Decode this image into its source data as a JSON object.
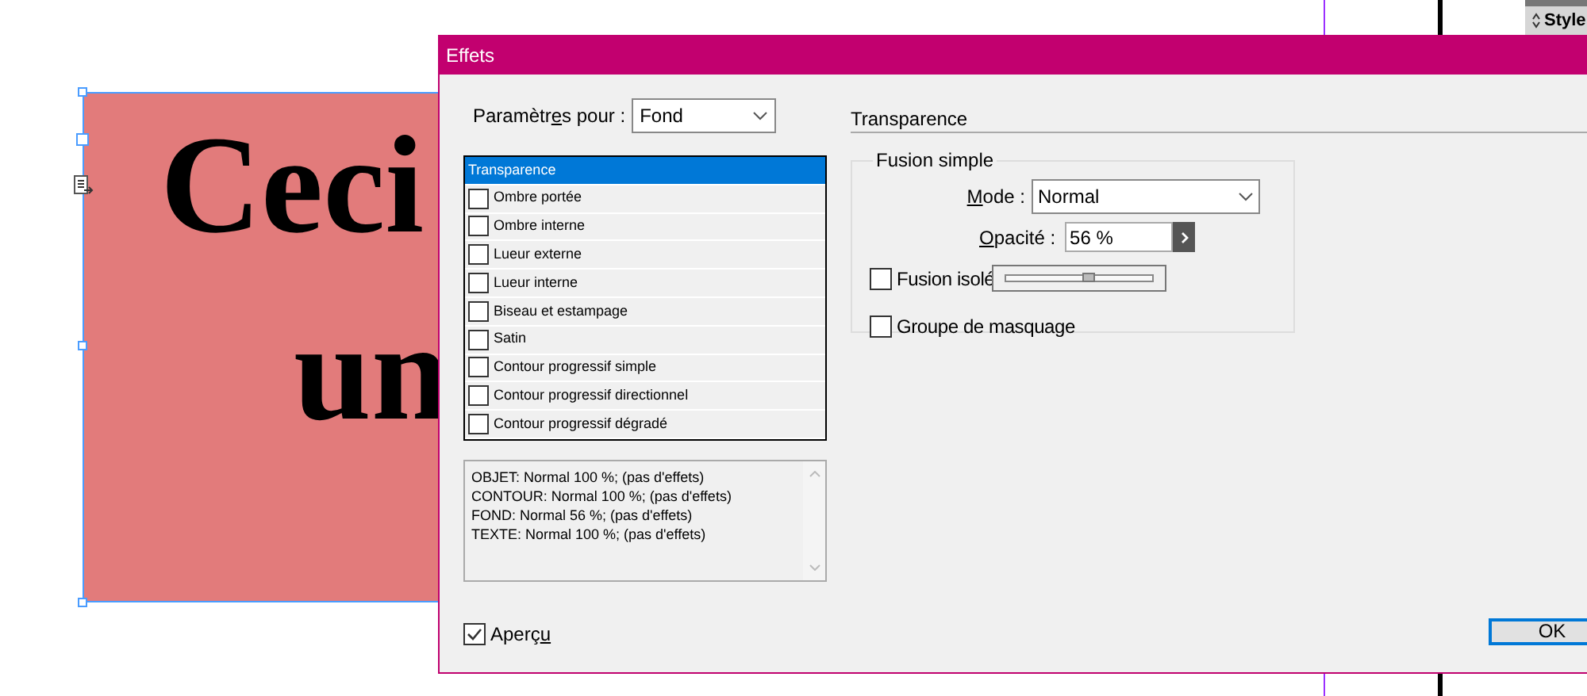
{
  "canvas": {
    "frame_lines": [
      "Ceci",
      "un"
    ],
    "panel_tab": {
      "label": "Style"
    }
  },
  "dialog": {
    "title": "Effets",
    "settings_for": {
      "label_parts": {
        "before": "Paramètr",
        "key": "e",
        "after": "s pour :"
      },
      "value": "Fond"
    },
    "effects": [
      {
        "kind": "plain",
        "label": "Transparence",
        "selected": true
      },
      {
        "kind": "checkbox",
        "label": "Ombre portée",
        "selected": false,
        "checked": false
      },
      {
        "kind": "checkbox",
        "label": "Ombre interne",
        "selected": false,
        "checked": false
      },
      {
        "kind": "checkbox",
        "label": "Lueur externe",
        "selected": false,
        "checked": false
      },
      {
        "kind": "checkbox",
        "label": "Lueur interne",
        "selected": false,
        "checked": false
      },
      {
        "kind": "checkbox",
        "label": "Biseau et estampage",
        "selected": false,
        "checked": false
      },
      {
        "kind": "checkbox",
        "label": "Satin",
        "selected": false,
        "checked": false
      },
      {
        "kind": "checkbox",
        "label": "Contour progressif simple",
        "selected": false,
        "checked": false
      },
      {
        "kind": "checkbox",
        "label": "Contour progressif directionnel",
        "selected": false,
        "checked": false
      },
      {
        "kind": "checkbox",
        "label": "Contour progressif dégradé",
        "selected": false,
        "checked": false
      }
    ],
    "summary": [
      "OBJET: Normal 100 %; (pas d'effets)",
      "CONTOUR: Normal 100 %; (pas d'effets)",
      "FOND: Normal 56 %; (pas d'effets)",
      "TEXTE: Normal 100 %; (pas d'effets)"
    ],
    "preview": {
      "label_parts": {
        "before": "Aperç",
        "key": "u"
      },
      "checked": true
    },
    "section_title": "Transparence",
    "group_title": "Fusion simple",
    "mode": {
      "label_parts": {
        "key": "M",
        "after": "ode :"
      },
      "value": "Normal"
    },
    "opacity": {
      "label_parts": {
        "key": "O",
        "after": "pacité :"
      },
      "value": "56 %",
      "slider_open": true,
      "level": 0.56
    },
    "options": [
      {
        "label": "Fusion isolé",
        "checked": false
      },
      {
        "label": "Groupe de masquage",
        "checked": false
      }
    ],
    "ok_button": "OK"
  }
}
